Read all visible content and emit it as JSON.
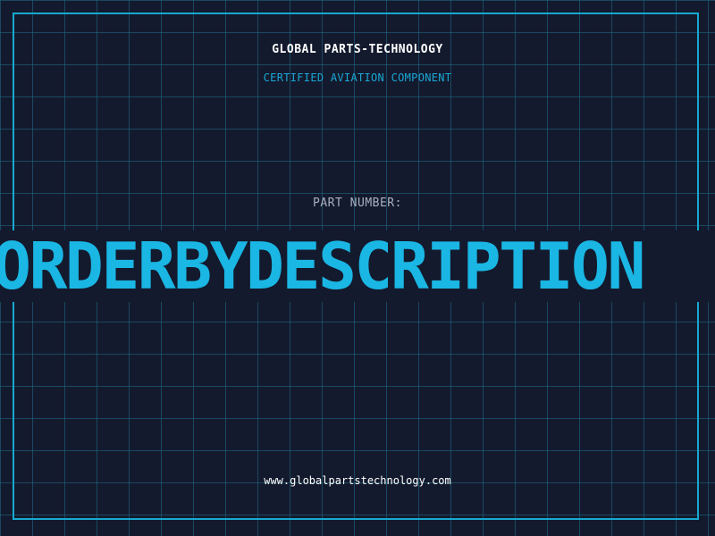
{
  "label": {
    "brand": "GLOBAL PARTS-TECHNOLOGY",
    "subtitle": "CERTIFIED AVIATION COMPONENT",
    "part_number_label": "PART NUMBER:",
    "part_number": "ORDERBYDESCRIPTION",
    "website": "www.globalpartstechnology.com"
  },
  "colors": {
    "background": "#131a2d",
    "grid": "#206e8c",
    "accent": "#1ab6e4",
    "text": "#ffffff",
    "muted": "#a8b0c0"
  }
}
